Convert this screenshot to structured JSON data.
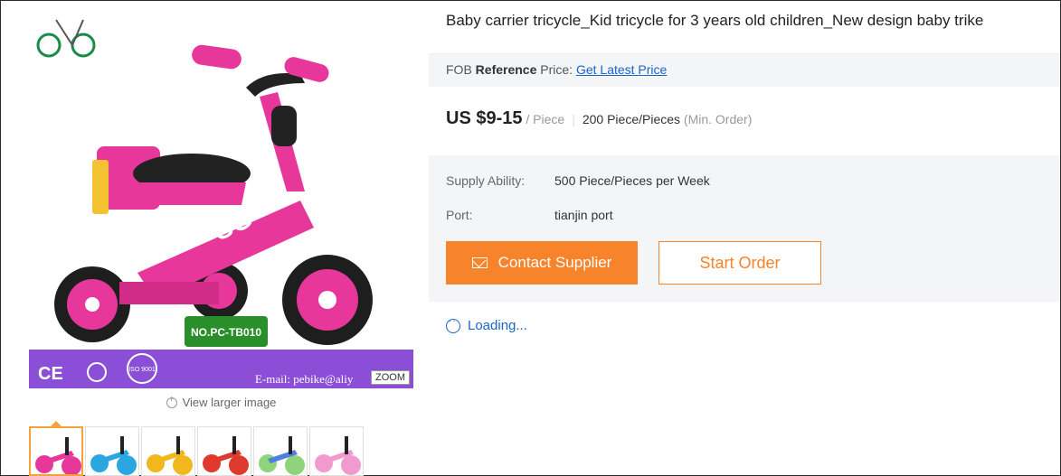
{
  "product": {
    "title": "Baby carrier tricycle_Kid tricycle for 3 years old children_New design baby trike",
    "image": {
      "model_label": "NO.PC-TB010",
      "email_text": "E-mail: pebike@aliy",
      "zoom_label": "ZOOM",
      "cert_ce": "CE",
      "cert_iso": "ISO 9001"
    },
    "view_larger_label": "View larger image",
    "thumbnails": [
      "pink tricycle",
      "blue tricycle",
      "yellow tricycle",
      "red tricycle",
      "green tricycle",
      "light pink tricycle"
    ]
  },
  "fob": {
    "prefix": "FOB ",
    "reference": "Reference",
    "suffix": " Price:",
    "link": "Get Latest Price"
  },
  "pricing": {
    "price": "US $9-15",
    "unit": "/ Piece",
    "moq": "200 Piece/Pieces",
    "moq_hint": "(Min. Order)"
  },
  "supply": {
    "ability_label": "Supply Ability:",
    "ability_value": "500 Piece/Pieces per Week",
    "port_label": "Port:",
    "port_value": "tianjin port"
  },
  "actions": {
    "contact_label": "Contact Supplier",
    "order_label": "Start Order"
  },
  "status": {
    "loading_label": "Loading..."
  },
  "colors": {
    "accent": "#f7832a",
    "link": "#1a64c8",
    "panel": "#f4f5f7",
    "product_pink": "#e8379a"
  }
}
